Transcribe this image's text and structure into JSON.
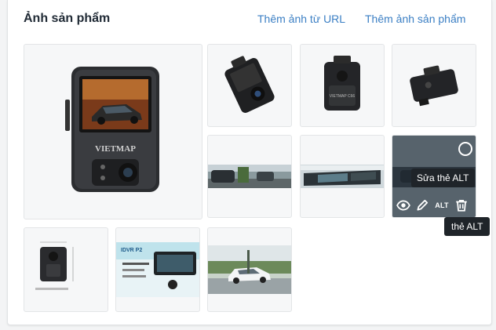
{
  "section": {
    "title": "Ảnh sản phẩm",
    "add_from_url_label": "Thêm ảnh từ URL",
    "add_image_label": "Thêm ảnh sản phẩm"
  },
  "images": [
    {
      "name": "main-dashcam-image",
      "brand": "VIETMAP"
    },
    {
      "name": "dashcam-side-image"
    },
    {
      "name": "dashcam-rear-image",
      "brand": "VIETMAP C66"
    },
    {
      "name": "dashcam-top-image"
    },
    {
      "name": "road-scene-image"
    },
    {
      "name": "rearview-mirror-image"
    },
    {
      "name": "hovered-image"
    },
    {
      "name": "dimensions-image"
    },
    {
      "name": "idvr-banner-image",
      "brand": "IDVR P2"
    },
    {
      "name": "white-car-image"
    }
  ],
  "hover_overlay": {
    "tooltip_edit_alt": "Sửa thẻ ALT",
    "alt_button_label": "ALT",
    "tooltip_alt_tag": "thẻ ALT",
    "icons": [
      "eye-icon",
      "pencil-icon",
      "alt-label",
      "trash-icon",
      "select-circle-icon"
    ]
  },
  "colors": {
    "link": "#3b7fc4",
    "overlay": "#212b36",
    "tooltip": "#1f2429"
  }
}
